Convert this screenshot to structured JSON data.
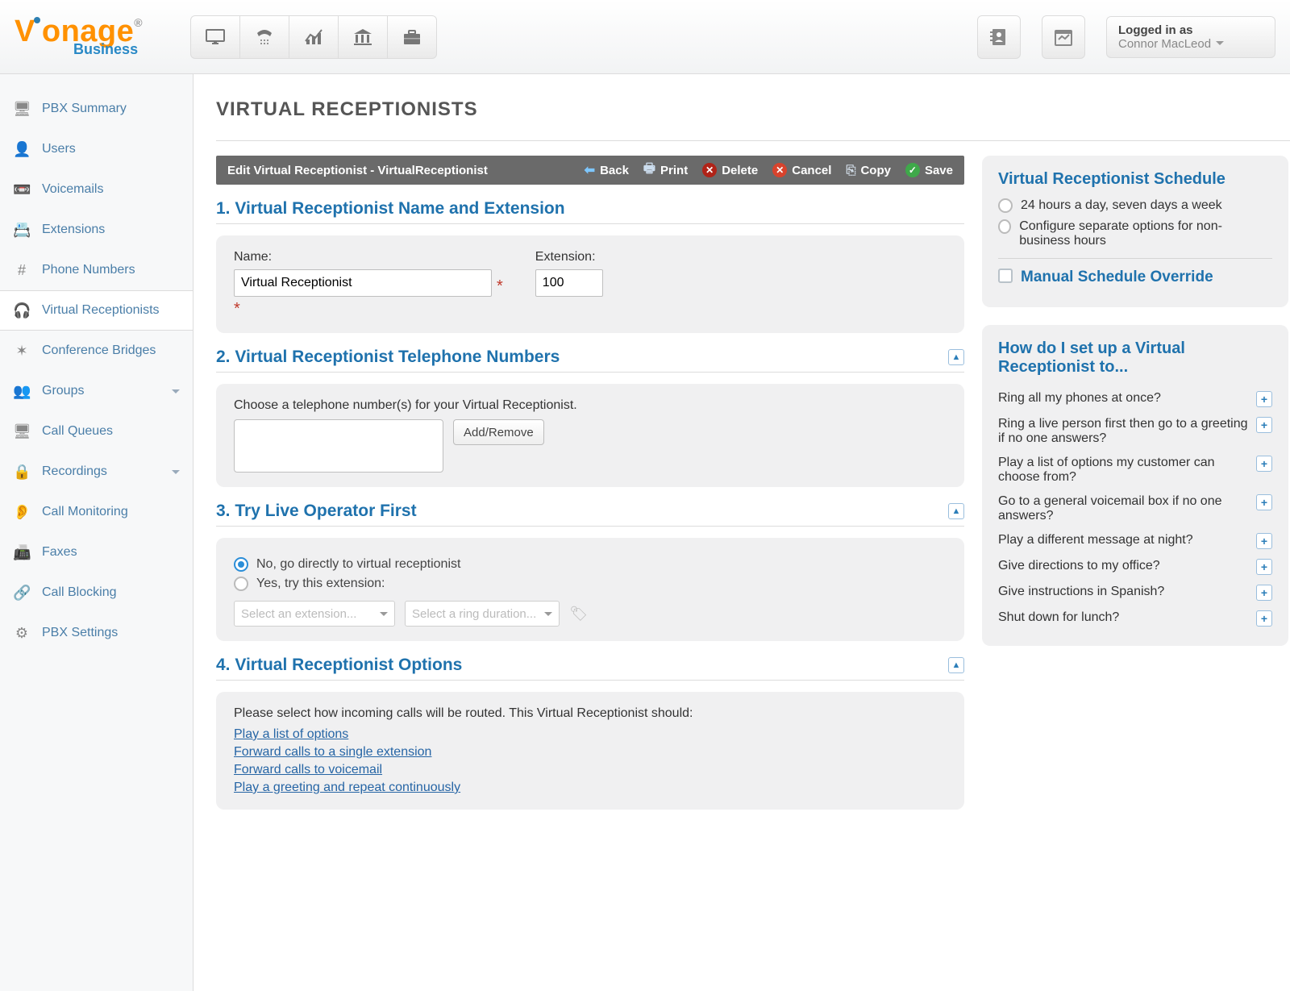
{
  "brand": {
    "line1": "Vonage",
    "reg": "®",
    "line2": "Business"
  },
  "topIcons": [
    "desktop",
    "fax",
    "chart",
    "bank",
    "briefcase"
  ],
  "login": {
    "label": "Logged in as",
    "user": "Connor MacLeod"
  },
  "sidebar": {
    "items": [
      {
        "label": "PBX Summary"
      },
      {
        "label": "Users"
      },
      {
        "label": "Voicemails"
      },
      {
        "label": "Extensions"
      },
      {
        "label": "Phone Numbers"
      },
      {
        "label": "Virtual Receptionists",
        "active": true
      },
      {
        "label": "Conference Bridges"
      },
      {
        "label": "Groups",
        "dropdown": true
      },
      {
        "label": "Call Queues"
      },
      {
        "label": "Recordings",
        "dropdown": true
      },
      {
        "label": "Call Monitoring"
      },
      {
        "label": "Faxes"
      },
      {
        "label": "Call Blocking"
      },
      {
        "label": "PBX Settings"
      }
    ]
  },
  "page": {
    "title": "VIRTUAL RECEPTIONISTS"
  },
  "actionbar": {
    "title": "Edit Virtual Receptionist - VirtualReceptionist",
    "back": "Back",
    "print": "Print",
    "delete": "Delete",
    "cancel": "Cancel",
    "copy": "Copy",
    "save": "Save"
  },
  "sec1": {
    "title": "1. Virtual Receptionist Name and Extension",
    "nameLabel": "Name:",
    "nameValue": "Virtual Receptionist",
    "extLabel": "Extension:",
    "extValue": "100"
  },
  "sec2": {
    "title": "2. Virtual Receptionist Telephone Numbers",
    "desc": "Choose a telephone number(s) for your Virtual Receptionist.",
    "btn": "Add/Remove"
  },
  "sec3": {
    "title": "3. Try Live Operator First",
    "optNo": "No, go directly to virtual receptionist",
    "optYes": "Yes, try this extension:",
    "ph1": "Select an extension...",
    "ph2": "Select a ring duration..."
  },
  "sec4": {
    "title": "4. Virtual Receptionist Options",
    "desc": "Please select how incoming calls will be routed. This Virtual Receptionist should:",
    "links": [
      "Play a list of options",
      "Forward calls to a single extension",
      "Forward calls to voicemail",
      "Play a greeting and repeat continuously"
    ]
  },
  "schedule": {
    "title": "Virtual Receptionist Schedule",
    "opt1": "24 hours a day, seven days a week",
    "opt2": "Configure separate options for non-business hours",
    "mso": "Manual Schedule Override"
  },
  "faq": {
    "title": "How do I set up a Virtual Receptionist to...",
    "items": [
      "Ring all my phones at once?",
      "Ring a live person first then go to a greeting if no one answers?",
      "Play a list of options my customer can choose from?",
      "Go to a general voicemail box if no one answers?",
      "Play a different message at night?",
      "Give directions to my office?",
      "Give instructions in Spanish?",
      "Shut down for lunch?"
    ]
  }
}
